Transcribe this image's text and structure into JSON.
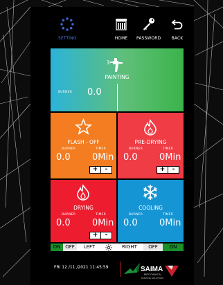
{
  "nav": {
    "setting": "SETTING",
    "home": "HOME",
    "password": "PASSWORD",
    "back": "BACK"
  },
  "painting": {
    "name": "PAINTING",
    "burner_label": "BURNER",
    "burner_value": "0.0",
    "color": "#2bb3d9"
  },
  "flash_off": {
    "name": "FLASH - OFF",
    "burner_label": "BURNER",
    "timer_label": "TIMER",
    "burner_value": "0.0",
    "timer_value": "0Min",
    "color": "#f37d20"
  },
  "pre_drying": {
    "name": "PRE-DRYING",
    "burner_label": "BURNER",
    "timer_label": "TIMER",
    "burner_value": "0.0",
    "timer_value": "0Min",
    "color": "#f03c45"
  },
  "drying": {
    "name": "DRYING",
    "burner_label": "BURNER",
    "timer_label": "TIMER",
    "burner_value": "0.0",
    "timer_value": "0Min",
    "color": "#ee1c2f"
  },
  "cooling": {
    "name": "COOLING",
    "burner_label": "BURNER",
    "timer_label": "TIMER",
    "burner_value": "0.0",
    "timer_value": "0Min",
    "color": "#1595d3"
  },
  "stepper": {
    "plus": "+",
    "minus": "-"
  },
  "lights": {
    "left_on": "ON",
    "left_off": "OFF",
    "left": "LEFT",
    "right": "RIGHT",
    "right_off": "OFF",
    "right_on": "ON"
  },
  "datetime": "FRI  12 /11 /2021  11:45:59",
  "logo": {
    "brand": "SAIMA",
    "sub1": "MECCANICA",
    "sub2": "PAINTING SOLUTIONS"
  }
}
